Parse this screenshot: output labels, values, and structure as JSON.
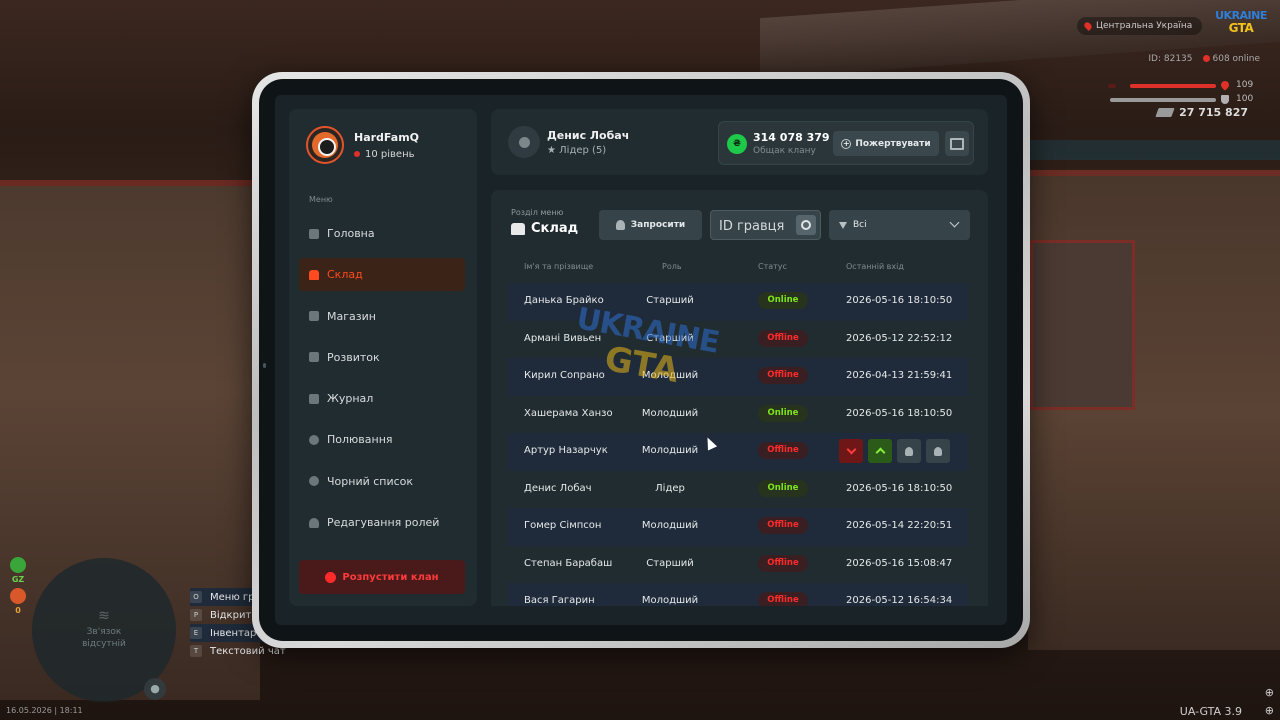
{
  "hud": {
    "region": "Центральна Україна",
    "logo_line1": "UKRAINE",
    "logo_line2": "GTA",
    "player_id": "ID: 82135",
    "online": "608 online",
    "health_value": "109",
    "armor_value": "100",
    "money": "27 715 827",
    "stat_gz": "GZ",
    "stat_zero": "0",
    "minimap_text": "Зв'язок відсутній",
    "hints": [
      {
        "key": "O",
        "label": "Меню гравця"
      },
      {
        "key": "P",
        "label": "Відкрити меню"
      },
      {
        "key": "E",
        "label": "Інвентар"
      },
      {
        "key": "T",
        "label": "Текстовий чат"
      }
    ],
    "datetime": "16.05.2026 | 18:11",
    "version": "UA-GTA 3.9"
  },
  "sidebar": {
    "user_name": "HardFamQ",
    "user_level": "10 рівень",
    "menu_caption": "Меню",
    "items": [
      {
        "label": "Головна"
      },
      {
        "label": "Склад"
      },
      {
        "label": "Магазин"
      },
      {
        "label": "Розвиток"
      },
      {
        "label": "Журнал"
      },
      {
        "label": "Полювання"
      },
      {
        "label": "Чорний список"
      },
      {
        "label": "Редагування ролей"
      }
    ],
    "active_index": 1,
    "dissolve_label": "Розпустити клан"
  },
  "topcard": {
    "leader_name": "Денис Лобач",
    "leader_rank": "Лідер (5)",
    "fund_amount": "314 078 379",
    "fund_caption": "Общак клану",
    "donate_label": "Пожертвувати"
  },
  "main": {
    "section_caption": "Розділ меню",
    "section_title": "Склад",
    "invite_label": "Запросити",
    "search_placeholder": "ID гравця",
    "filter_label": "Всі",
    "columns": [
      "Ім'я та прізвище",
      "Роль",
      "Статус",
      "Останній вхід"
    ],
    "rows": [
      {
        "name": "Данька Брайко",
        "role": "Старший",
        "status": "Online",
        "last": "2026-05-16 18:10:50"
      },
      {
        "name": "Армані Вивьен",
        "role": "Старший",
        "status": "Offline",
        "last": "2026-05-12 22:52:12"
      },
      {
        "name": "Кирил Сопрано",
        "role": "Молодший",
        "status": "Offline",
        "last": "2026-04-13 21:59:41"
      },
      {
        "name": "Хашерама Ханзо",
        "role": "Молодший",
        "status": "Online",
        "last": "2026-05-16 18:10:50"
      },
      {
        "name": "Артур Назарчук",
        "role": "Молодший",
        "status": "Offline",
        "last": ""
      },
      {
        "name": "Денис Лобач",
        "role": "Лідер",
        "status": "Online",
        "last": "2026-05-16 18:10:50"
      },
      {
        "name": "Гомер Сімпсон",
        "role": "Молодший",
        "status": "Offline",
        "last": "2026-05-14 22:20:51"
      },
      {
        "name": "Степан Барабаш",
        "role": "Старший",
        "status": "Offline",
        "last": "2026-05-16 15:08:47"
      },
      {
        "name": "Вася Гагарин",
        "role": "Молодший",
        "status": "Offline",
        "last": "2026-05-12 16:54:34"
      }
    ],
    "hover_row_index": 4
  },
  "watermark": {
    "line1": "UKRAINE",
    "line2": "GTA"
  },
  "colors": {
    "accent": "#ff4a1f",
    "online": "#7fe31b",
    "offline": "#ff2a2a",
    "fund_coin": "#1ec94a",
    "health": "#e0302a"
  }
}
